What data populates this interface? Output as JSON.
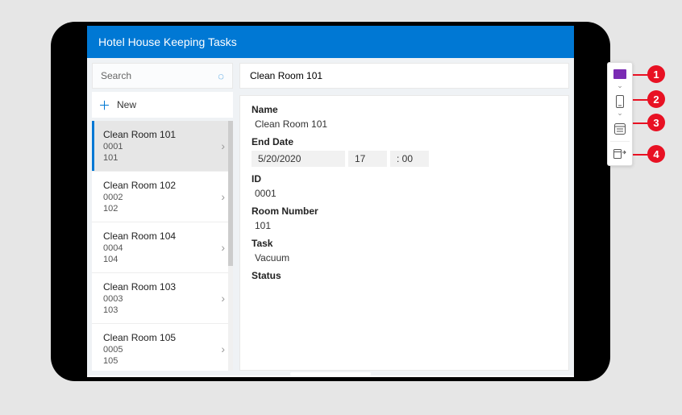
{
  "app": {
    "title": "Hotel House Keeping Tasks"
  },
  "search": {
    "placeholder": "Search"
  },
  "newButton": {
    "label": "New"
  },
  "tasks": [
    {
      "title": "Clean Room 101",
      "id": "0001",
      "room": "101"
    },
    {
      "title": "Clean Room 102",
      "id": "0002",
      "room": "102"
    },
    {
      "title": "Clean Room 104",
      "id": "0004",
      "room": "104"
    },
    {
      "title": "Clean Room 103",
      "id": "0003",
      "room": "103"
    },
    {
      "title": "Clean Room 105",
      "id": "0005",
      "room": "105"
    }
  ],
  "detail": {
    "header": "Clean Room 101",
    "labels": {
      "name": "Name",
      "endDate": "End Date",
      "id": "ID",
      "roomNumber": "Room Number",
      "task": "Task",
      "status": "Status"
    },
    "values": {
      "name": "Clean Room 101",
      "endDateDate": "5/20/2020",
      "endDateHour": "17",
      "endDateMin": ": 00",
      "id": "0001",
      "roomNumber": "101",
      "task": "Vacuum"
    }
  },
  "toolPanel": {
    "items": [
      "designer-view",
      "phone-preview",
      "form-settings",
      "layout-panel"
    ]
  },
  "annotations": [
    "1",
    "2",
    "3",
    "4"
  ]
}
